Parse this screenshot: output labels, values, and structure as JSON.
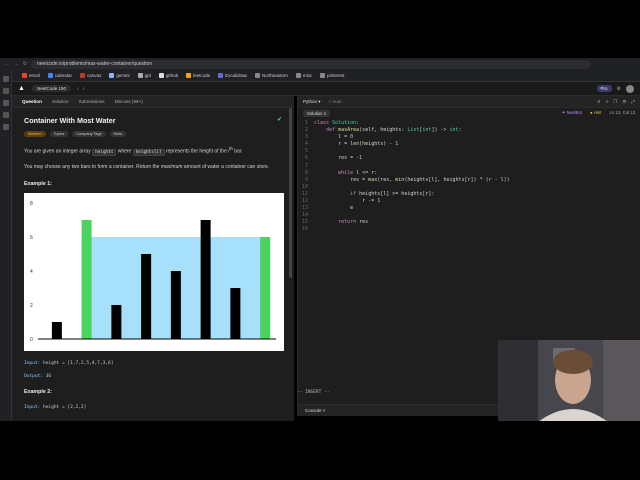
{
  "browser": {
    "url": "neetcode.io/problems/max-water-container/question",
    "bookmarks": [
      "email",
      "calendar",
      "canvas",
      "gemini",
      "gpt",
      "github",
      "leetcode",
      "Excalidraw",
      "Northeastern",
      "misc",
      "pinterest"
    ]
  },
  "app": {
    "course": "NeetCode 150",
    "pro_label": "Pro"
  },
  "left_tabs": [
    "Question",
    "Solution",
    "Submissions",
    "Discuss (99+)"
  ],
  "question": {
    "title": "Container With Most Water",
    "tags": [
      "Medium",
      "Topics",
      "Company Tags",
      "Hints"
    ],
    "desc1_a": "You are given an integer array",
    "desc1_code1": "heights",
    "desc1_b": "where",
    "desc1_code2": "heights[i]",
    "desc1_c": "represents the height of the",
    "desc1_sup": "th",
    "desc1_d": "bar.",
    "desc1_i": "i",
    "desc2_a": "You may choose any two bars to form a container. Return the",
    "desc2_em": "maximum",
    "desc2_b": "amount of water a container can store.",
    "example1": "Example 1:",
    "input_label": "Input:",
    "input_value": "height = [1,7,2,5,4,7,3,6]",
    "output_label": "Output:",
    "output_value": "36",
    "example2": "Example 2:",
    "input2_value": "height = [2,2,2]"
  },
  "chart_data": {
    "type": "bar",
    "values": [
      1,
      7,
      2,
      5,
      4,
      7,
      3,
      6
    ],
    "highlight_indices": [
      1,
      7
    ],
    "water_level": 6,
    "water_range": [
      1,
      7
    ],
    "y_ticks": [
      0,
      2,
      4,
      6,
      8
    ],
    "ylim": [
      0,
      8
    ],
    "colors": {
      "bar": "#000000",
      "highlight": "#4cd35e",
      "water": "#a6e0fb"
    }
  },
  "editor": {
    "language": "Python",
    "auto": "Auto",
    "tab": "Solution 1",
    "neetbot": "NeetBot",
    "hint": "Hint",
    "cursor_pos": "Ln 13, Col 13",
    "mode": "-- INSERT --",
    "console": "Console"
  },
  "code_lines": [
    "class Solution:",
    "    def maxArea(self, heights: List[int]) -> int:",
    "        l = 0",
    "        r = len(heights) - 1",
    "",
    "        res = -1",
    "",
    "        while l <= r:",
    "            res = max(res, min(heights[l], heights[r]) * (r - l))",
    "",
    "            if heights[l] >= heights[r]:",
    "                r -= 1",
    "            e",
    "",
    "        return res",
    ""
  ]
}
